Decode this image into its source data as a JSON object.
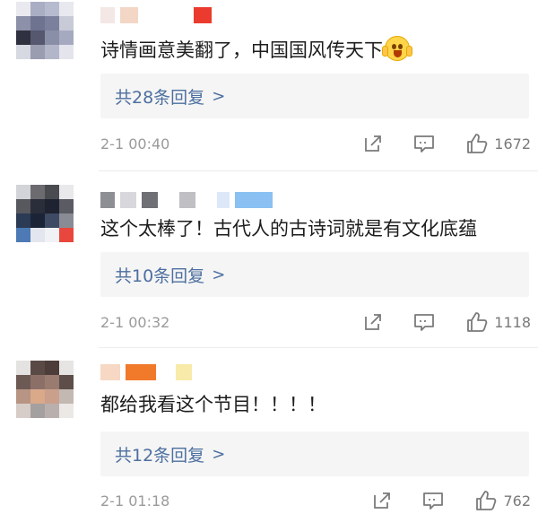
{
  "comments": [
    {
      "text": "诗情画意美翻了，中国国风传天下",
      "emoji": "scream-face-emoji",
      "replies_label": "共28条回复",
      "reply_arrow": ">",
      "timestamp": "2-1 00:40",
      "likes": "1672"
    },
    {
      "text": "这个太棒了！古代人的古诗词就是有文化底蕴",
      "replies_label": "共10条回复",
      "reply_arrow": ">",
      "timestamp": "2-1 00:32",
      "likes": "1118"
    },
    {
      "text": "都给我看这个节目！！！！",
      "replies_label": "共12条回复",
      "reply_arrow": ">",
      "timestamp": "2-1 01:18",
      "likes": "762"
    }
  ],
  "icons": {
    "share": "share-icon",
    "comment": "comment-icon",
    "like": "thumbs-up-icon"
  },
  "colors": {
    "reply_link": "#4d6fa0",
    "reply_background": "#f5f5f5",
    "meta_text": "#9a9a9a"
  }
}
